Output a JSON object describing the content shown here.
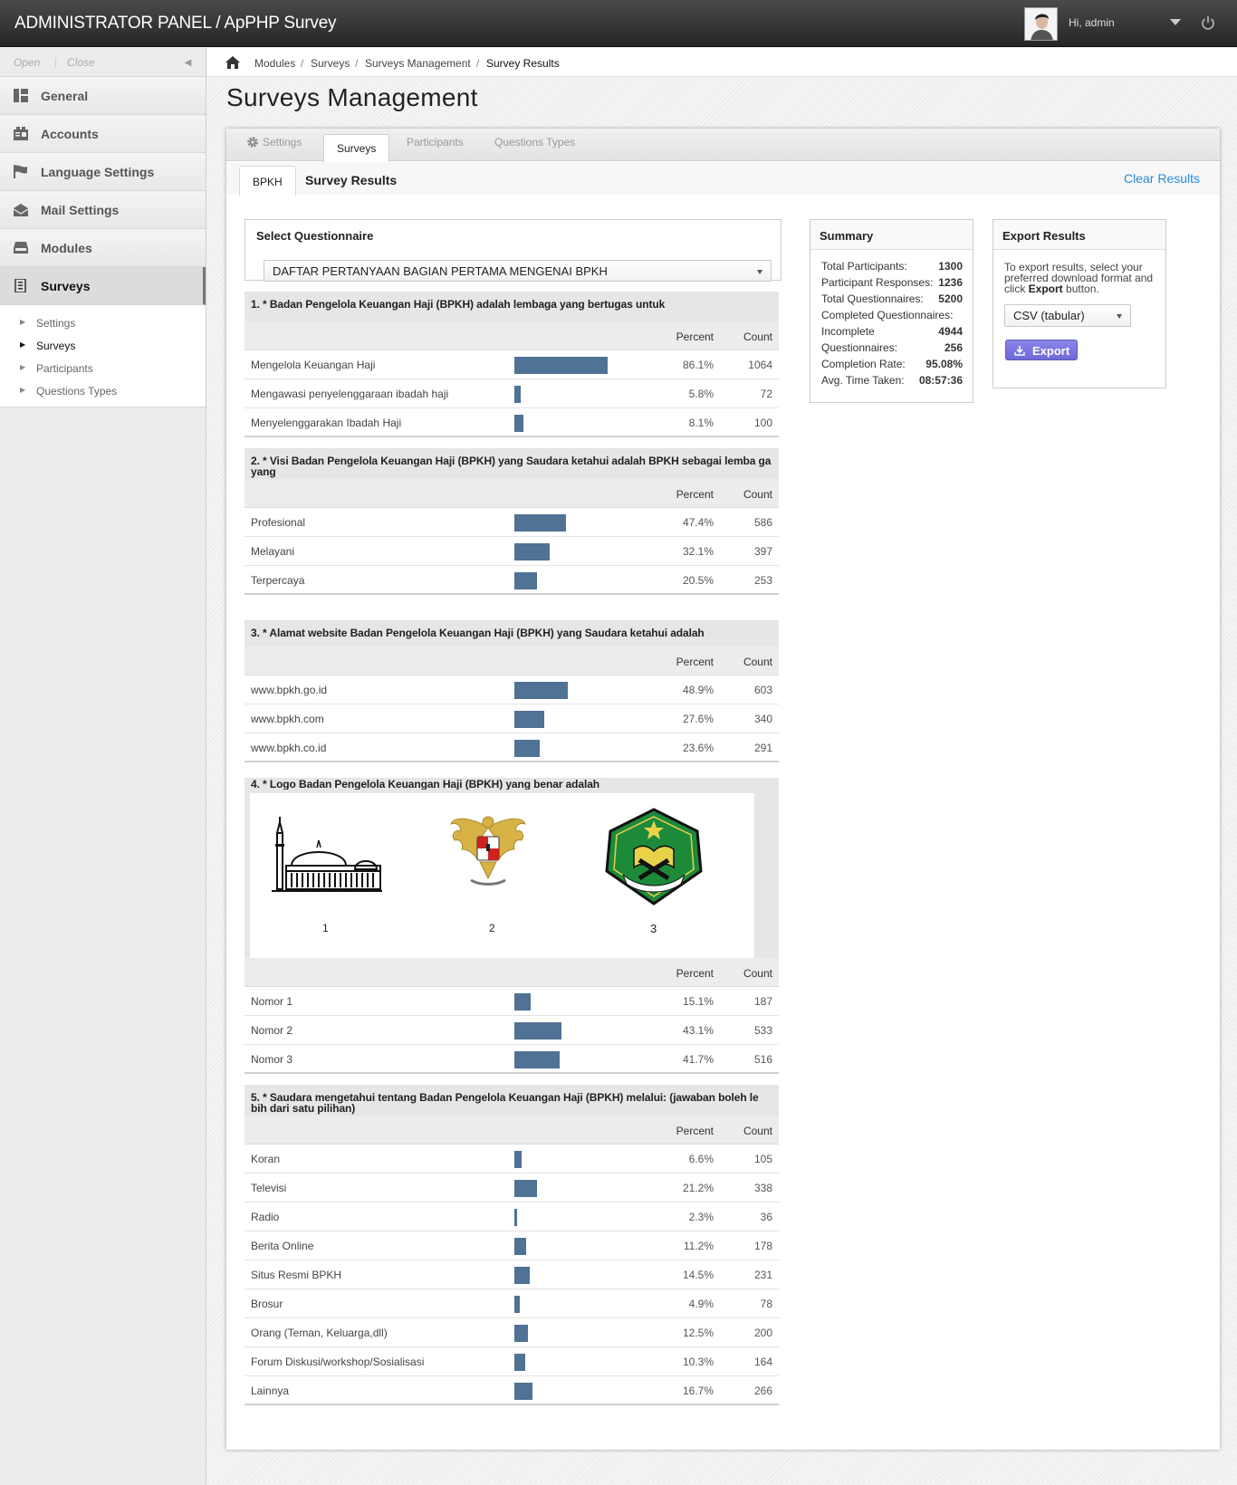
{
  "header": {
    "title": "ADMINISTRATOR PANEL / ApPHP Survey",
    "greeting": "Hi, admin"
  },
  "sidebar": {
    "open_label": "Open",
    "close_label": "Close",
    "items": [
      {
        "label": "General",
        "icon": "dashboard-icon"
      },
      {
        "label": "Accounts",
        "icon": "accounts-icon"
      },
      {
        "label": "Language Settings",
        "icon": "flag-icon"
      },
      {
        "label": "Mail Settings",
        "icon": "mail-icon"
      },
      {
        "label": "Modules",
        "icon": "modules-icon"
      },
      {
        "label": "Surveys",
        "icon": "surveys-icon"
      }
    ],
    "subitems": [
      "Settings",
      "Surveys",
      "Participants",
      "Questions Types"
    ]
  },
  "breadcrumb": [
    "Modules",
    "Surveys",
    "Surveys Management",
    "Survey Results"
  ],
  "page_title": "Surveys Management",
  "tabs": [
    "Settings",
    "Surveys",
    "Participants",
    "Questions Types"
  ],
  "subtab": "BPKH",
  "subtitle": "Survey Results",
  "clear_results": "Clear Results",
  "questionnaire": {
    "title": "Select Questionnaire",
    "selected": "DAFTAR PERTANYAAN BAGIAN PERTAMA MENGENAI BPKH"
  },
  "columns": {
    "percent": "Percent",
    "count": "Count"
  },
  "questions": [
    {
      "head": "1.  *  Badan Pengelola Keuangan Haji (BPKH) adalah lembaga yang bertugas untuk",
      "answers": [
        {
          "label": "Mengelola Keuangan Haji",
          "percent": "86.1%",
          "count": "1064",
          "value": 86.1
        },
        {
          "label": "Mengawasi penyelenggaraan ibadah haji",
          "percent": "5.8%",
          "count": "72",
          "value": 5.8
        },
        {
          "label": "Menyelenggarakan Ibadah Haji",
          "percent": "8.1%",
          "count": "100",
          "value": 8.1
        }
      ]
    },
    {
      "head": "2.  *  Visi Badan Pengelola Keuangan Haji (BPKH) yang Saudara ketahui adalah BPKH sebagai lemba ga yang",
      "answers": [
        {
          "label": "Profesional",
          "percent": "47.4%",
          "count": "586",
          "value": 47.4
        },
        {
          "label": "Melayani",
          "percent": "32.1%",
          "count": "397",
          "value": 32.1
        },
        {
          "label": "Terpercaya",
          "percent": "20.5%",
          "count": "253",
          "value": 20.5
        }
      ]
    },
    {
      "head": "3.  *  Alamat website Badan Pengelola Keuangan Haji (BPKH) yang Saudara ketahui adalah",
      "answers": [
        {
          "label": "www.bpkh.go.id",
          "percent": "48.9%",
          "count": "603",
          "value": 48.9
        },
        {
          "label": "www.bpkh.com",
          "percent": "27.6%",
          "count": "340",
          "value": 27.6
        },
        {
          "label": "www.bpkh.co.id",
          "percent": "23.6%",
          "count": "291",
          "value": 23.6
        }
      ]
    },
    {
      "head": "4.  *  Logo Badan Pengelola Keuangan Haji (BPKH) yang benar adalah",
      "logo_labels": [
        "1",
        "2",
        "3"
      ],
      "answers": [
        {
          "label": "Nomor 1",
          "percent": "15.1%",
          "count": "187",
          "value": 15.1
        },
        {
          "label": "Nomor 2",
          "percent": "43.1%",
          "count": "533",
          "value": 43.1
        },
        {
          "label": "Nomor 3",
          "percent": "41.7%",
          "count": "516",
          "value": 41.7
        }
      ]
    },
    {
      "head": "5.  *  Saudara mengetahui tentang Badan Pengelola Keuangan Haji (BPKH) melalui: (jawaban boleh le bih dari satu pilihan)",
      "answers": [
        {
          "label": "Koran",
          "percent": "6.6%",
          "count": "105",
          "value": 6.6
        },
        {
          "label": "Televisi",
          "percent": "21.2%",
          "count": "338",
          "value": 21.2
        },
        {
          "label": "Radio",
          "percent": "2.3%",
          "count": "36",
          "value": 2.3
        },
        {
          "label": "Berita Online",
          "percent": "11.2%",
          "count": "178",
          "value": 11.2
        },
        {
          "label": "Situs Resmi BPKH",
          "percent": "14.5%",
          "count": "231",
          "value": 14.5
        },
        {
          "label": "Brosur",
          "percent": "4.9%",
          "count": "78",
          "value": 4.9
        },
        {
          "label": "Orang (Teman, Keluarga,dll)",
          "percent": "12.5%",
          "count": "200",
          "value": 12.5
        },
        {
          "label": "Forum Diskusi/workshop/Sosialisasi",
          "percent": "10.3%",
          "count": "164",
          "value": 10.3
        },
        {
          "label": "Lainnya",
          "percent": "16.7%",
          "count": "266",
          "value": 16.7
        }
      ]
    }
  ],
  "summary": {
    "title": "Summary",
    "rows": [
      {
        "label": "Total Participants:",
        "value": "1300"
      },
      {
        "label": "Participant Responses:",
        "value": "1236"
      },
      {
        "label": "Total Questionnaires:",
        "value": "5200"
      },
      {
        "label": "Completed Questionnaires:",
        "value": ""
      },
      {
        "label": "Incomplete",
        "value": "4944"
      },
      {
        "label": "Questionnaires:",
        "value": "256"
      },
      {
        "label": "Completion Rate:",
        "value": "95.08%"
      },
      {
        "label": "Avg. Time Taken:",
        "value": "08:57:36"
      }
    ]
  },
  "export": {
    "title": "Export Results",
    "text_before": "To export results, select your preferred download format and click ",
    "text_bold": "Export",
    "text_after": " button.",
    "format": "CSV (tabular)",
    "button": "Export"
  },
  "colors": {
    "bar": "#4f7295",
    "link": "#2a8ad8",
    "export_button": "#7a76e0",
    "header": "#333333"
  }
}
